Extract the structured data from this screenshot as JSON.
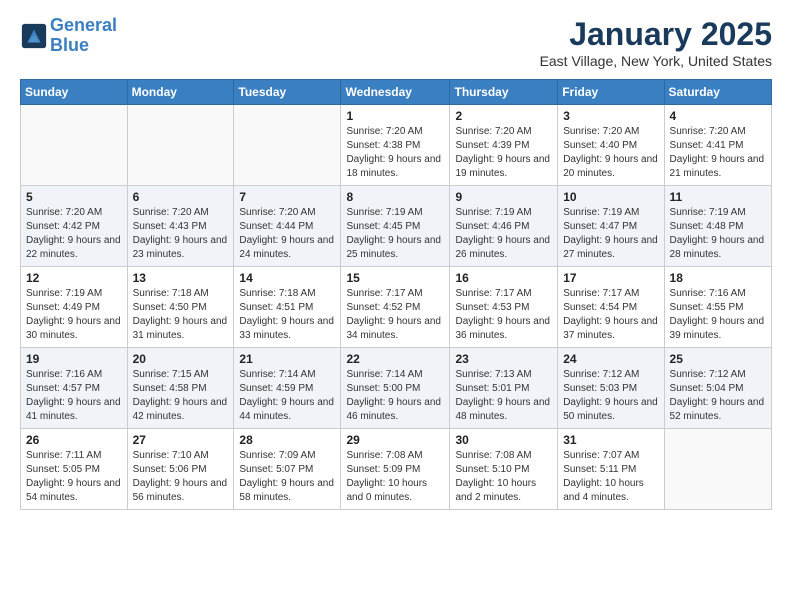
{
  "header": {
    "logo_line1": "General",
    "logo_line2": "Blue",
    "month": "January 2025",
    "location": "East Village, New York, United States"
  },
  "weekdays": [
    "Sunday",
    "Monday",
    "Tuesday",
    "Wednesday",
    "Thursday",
    "Friday",
    "Saturday"
  ],
  "weeks": [
    [
      {
        "day": "",
        "sunrise": "",
        "sunset": "",
        "daylight": ""
      },
      {
        "day": "",
        "sunrise": "",
        "sunset": "",
        "daylight": ""
      },
      {
        "day": "",
        "sunrise": "",
        "sunset": "",
        "daylight": ""
      },
      {
        "day": "1",
        "sunrise": "Sunrise: 7:20 AM",
        "sunset": "Sunset: 4:38 PM",
        "daylight": "Daylight: 9 hours and 18 minutes."
      },
      {
        "day": "2",
        "sunrise": "Sunrise: 7:20 AM",
        "sunset": "Sunset: 4:39 PM",
        "daylight": "Daylight: 9 hours and 19 minutes."
      },
      {
        "day": "3",
        "sunrise": "Sunrise: 7:20 AM",
        "sunset": "Sunset: 4:40 PM",
        "daylight": "Daylight: 9 hours and 20 minutes."
      },
      {
        "day": "4",
        "sunrise": "Sunrise: 7:20 AM",
        "sunset": "Sunset: 4:41 PM",
        "daylight": "Daylight: 9 hours and 21 minutes."
      }
    ],
    [
      {
        "day": "5",
        "sunrise": "Sunrise: 7:20 AM",
        "sunset": "Sunset: 4:42 PM",
        "daylight": "Daylight: 9 hours and 22 minutes."
      },
      {
        "day": "6",
        "sunrise": "Sunrise: 7:20 AM",
        "sunset": "Sunset: 4:43 PM",
        "daylight": "Daylight: 9 hours and 23 minutes."
      },
      {
        "day": "7",
        "sunrise": "Sunrise: 7:20 AM",
        "sunset": "Sunset: 4:44 PM",
        "daylight": "Daylight: 9 hours and 24 minutes."
      },
      {
        "day": "8",
        "sunrise": "Sunrise: 7:19 AM",
        "sunset": "Sunset: 4:45 PM",
        "daylight": "Daylight: 9 hours and 25 minutes."
      },
      {
        "day": "9",
        "sunrise": "Sunrise: 7:19 AM",
        "sunset": "Sunset: 4:46 PM",
        "daylight": "Daylight: 9 hours and 26 minutes."
      },
      {
        "day": "10",
        "sunrise": "Sunrise: 7:19 AM",
        "sunset": "Sunset: 4:47 PM",
        "daylight": "Daylight: 9 hours and 27 minutes."
      },
      {
        "day": "11",
        "sunrise": "Sunrise: 7:19 AM",
        "sunset": "Sunset: 4:48 PM",
        "daylight": "Daylight: 9 hours and 28 minutes."
      }
    ],
    [
      {
        "day": "12",
        "sunrise": "Sunrise: 7:19 AM",
        "sunset": "Sunset: 4:49 PM",
        "daylight": "Daylight: 9 hours and 30 minutes."
      },
      {
        "day": "13",
        "sunrise": "Sunrise: 7:18 AM",
        "sunset": "Sunset: 4:50 PM",
        "daylight": "Daylight: 9 hours and 31 minutes."
      },
      {
        "day": "14",
        "sunrise": "Sunrise: 7:18 AM",
        "sunset": "Sunset: 4:51 PM",
        "daylight": "Daylight: 9 hours and 33 minutes."
      },
      {
        "day": "15",
        "sunrise": "Sunrise: 7:17 AM",
        "sunset": "Sunset: 4:52 PM",
        "daylight": "Daylight: 9 hours and 34 minutes."
      },
      {
        "day": "16",
        "sunrise": "Sunrise: 7:17 AM",
        "sunset": "Sunset: 4:53 PM",
        "daylight": "Daylight: 9 hours and 36 minutes."
      },
      {
        "day": "17",
        "sunrise": "Sunrise: 7:17 AM",
        "sunset": "Sunset: 4:54 PM",
        "daylight": "Daylight: 9 hours and 37 minutes."
      },
      {
        "day": "18",
        "sunrise": "Sunrise: 7:16 AM",
        "sunset": "Sunset: 4:55 PM",
        "daylight": "Daylight: 9 hours and 39 minutes."
      }
    ],
    [
      {
        "day": "19",
        "sunrise": "Sunrise: 7:16 AM",
        "sunset": "Sunset: 4:57 PM",
        "daylight": "Daylight: 9 hours and 41 minutes."
      },
      {
        "day": "20",
        "sunrise": "Sunrise: 7:15 AM",
        "sunset": "Sunset: 4:58 PM",
        "daylight": "Daylight: 9 hours and 42 minutes."
      },
      {
        "day": "21",
        "sunrise": "Sunrise: 7:14 AM",
        "sunset": "Sunset: 4:59 PM",
        "daylight": "Daylight: 9 hours and 44 minutes."
      },
      {
        "day": "22",
        "sunrise": "Sunrise: 7:14 AM",
        "sunset": "Sunset: 5:00 PM",
        "daylight": "Daylight: 9 hours and 46 minutes."
      },
      {
        "day": "23",
        "sunrise": "Sunrise: 7:13 AM",
        "sunset": "Sunset: 5:01 PM",
        "daylight": "Daylight: 9 hours and 48 minutes."
      },
      {
        "day": "24",
        "sunrise": "Sunrise: 7:12 AM",
        "sunset": "Sunset: 5:03 PM",
        "daylight": "Daylight: 9 hours and 50 minutes."
      },
      {
        "day": "25",
        "sunrise": "Sunrise: 7:12 AM",
        "sunset": "Sunset: 5:04 PM",
        "daylight": "Daylight: 9 hours and 52 minutes."
      }
    ],
    [
      {
        "day": "26",
        "sunrise": "Sunrise: 7:11 AM",
        "sunset": "Sunset: 5:05 PM",
        "daylight": "Daylight: 9 hours and 54 minutes."
      },
      {
        "day": "27",
        "sunrise": "Sunrise: 7:10 AM",
        "sunset": "Sunset: 5:06 PM",
        "daylight": "Daylight: 9 hours and 56 minutes."
      },
      {
        "day": "28",
        "sunrise": "Sunrise: 7:09 AM",
        "sunset": "Sunset: 5:07 PM",
        "daylight": "Daylight: 9 hours and 58 minutes."
      },
      {
        "day": "29",
        "sunrise": "Sunrise: 7:08 AM",
        "sunset": "Sunset: 5:09 PM",
        "daylight": "Daylight: 10 hours and 0 minutes."
      },
      {
        "day": "30",
        "sunrise": "Sunrise: 7:08 AM",
        "sunset": "Sunset: 5:10 PM",
        "daylight": "Daylight: 10 hours and 2 minutes."
      },
      {
        "day": "31",
        "sunrise": "Sunrise: 7:07 AM",
        "sunset": "Sunset: 5:11 PM",
        "daylight": "Daylight: 10 hours and 4 minutes."
      },
      {
        "day": "",
        "sunrise": "",
        "sunset": "",
        "daylight": ""
      }
    ]
  ]
}
